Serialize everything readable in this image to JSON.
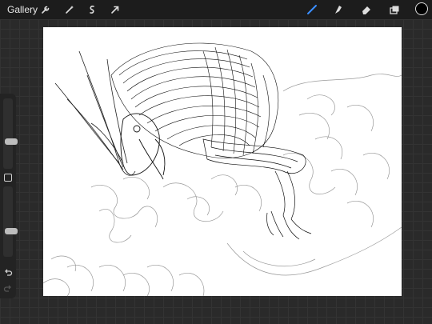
{
  "toolbar": {
    "gallery_label": "Gallery",
    "left_tools": [
      "wrench-icon",
      "magic-wand-icon",
      "selection-icon",
      "transform-arrow-icon"
    ],
    "right_tools": [
      "brush-icon",
      "smudge-icon",
      "eraser-icon",
      "layers-icon"
    ],
    "active_tool": "brush-icon",
    "accent_color": "#3a8fff",
    "current_color": "#000000"
  },
  "sidebar": {
    "brush_size": 0.38,
    "brush_opacity": 0.35,
    "controls": [
      "modify-square-icon",
      "undo-icon",
      "redo-icon"
    ]
  },
  "canvas": {
    "background": "#ffffff",
    "stroke_color": "#111111"
  }
}
